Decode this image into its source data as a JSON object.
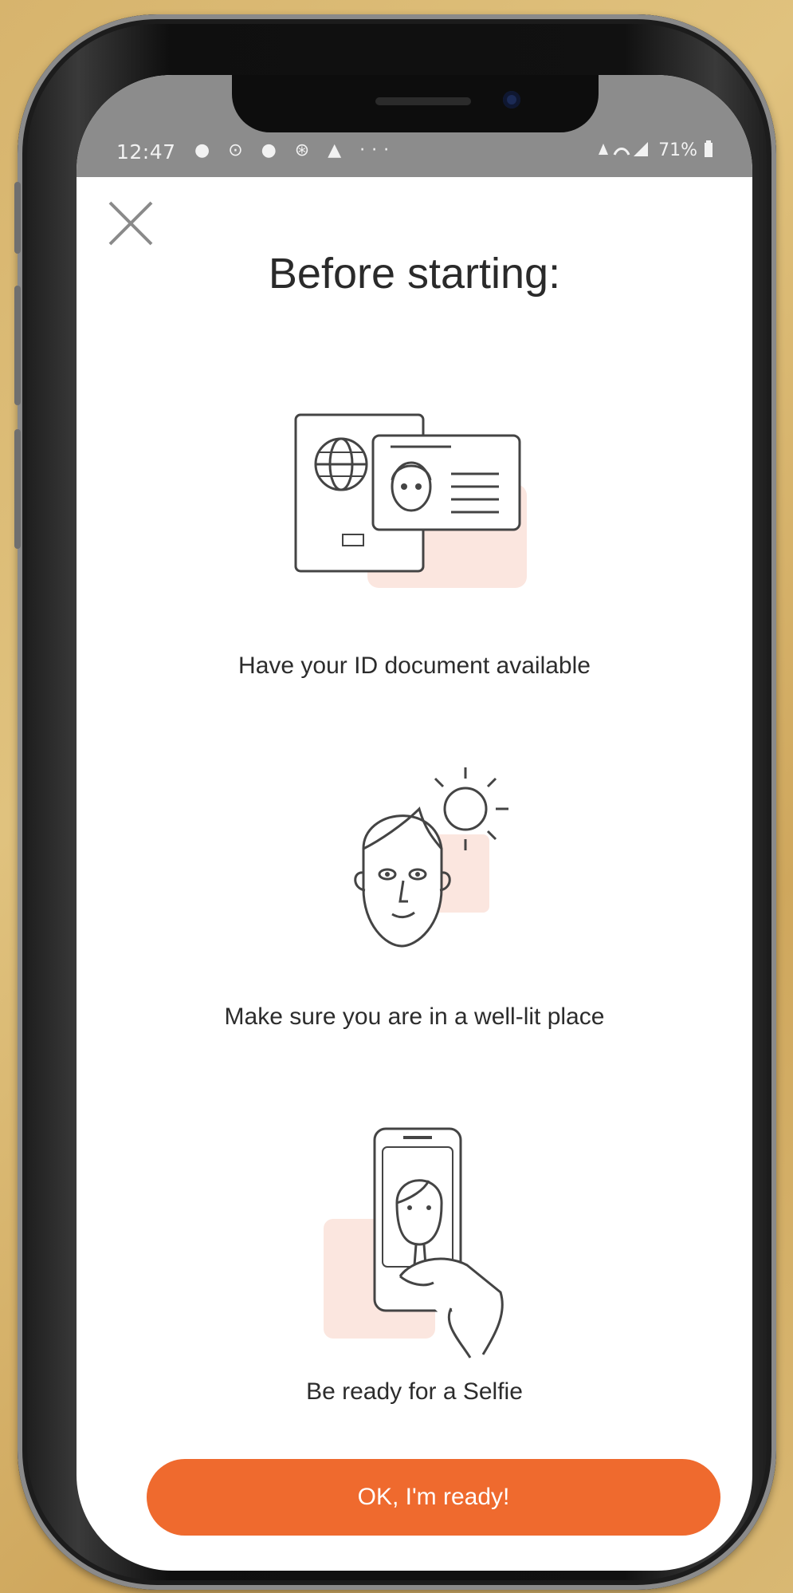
{
  "status_bar": {
    "time": "12:47",
    "left_icons": "● ⊙ ● ⊛ ▲ ···",
    "right_text": "71%"
  },
  "header": {
    "close_icon": "close-icon",
    "title": "Before starting:"
  },
  "steps": [
    {
      "icon": "id-document-icon",
      "label": "Have your ID document available"
    },
    {
      "icon": "well-lit-face-icon",
      "label": "Make sure you are in a well-lit place"
    },
    {
      "icon": "selfie-phone-icon",
      "label": "Be ready for a Selfie"
    }
  ],
  "cta": {
    "label": "OK, I'm ready!"
  },
  "colors": {
    "accent": "#ef6a2e",
    "highlight": "#fbe6df",
    "background": "#d7b46d"
  }
}
